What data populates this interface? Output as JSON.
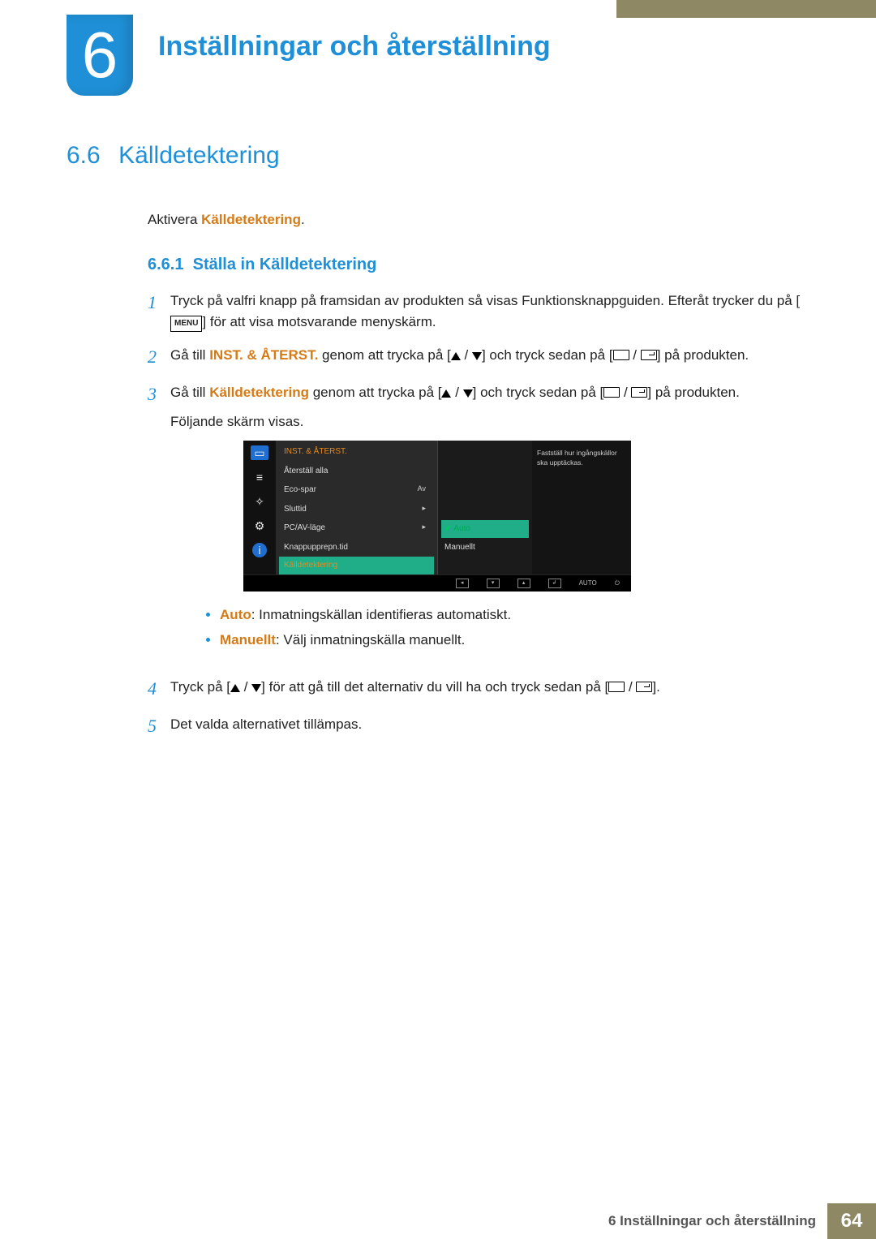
{
  "chapter": {
    "number": "6",
    "title": "Inställningar och återställning"
  },
  "section": {
    "number": "6.6",
    "title": "Källdetektering"
  },
  "intro": {
    "prefix": "Aktivera ",
    "keyword": "Källdetektering",
    "suffix": "."
  },
  "subsection": {
    "number": "6.6.1",
    "title": "Ställa in Källdetektering"
  },
  "steps": {
    "1": {
      "a": "Tryck på valfri knapp på framsidan av produkten så visas Funktionsknappguiden. Efteråt trycker du på [",
      "b": "] för att visa motsvarande menyskärm."
    },
    "2": {
      "a": "Gå till ",
      "kw": "INST. & ÅTERST.",
      "b": " genom att trycka på [",
      "c": "] och tryck sedan på [",
      "d": "] på produkten."
    },
    "3": {
      "a": "Gå till ",
      "kw": "Källdetektering",
      "b": " genom att trycka på [",
      "c": "] och tryck sedan på [",
      "d": "] på produkten.",
      "e": "Följande skärm visas."
    },
    "4": {
      "a": "Tryck på [",
      "b": "] för att gå till det alternativ du vill ha och tryck sedan på [",
      "c": "]."
    },
    "5": "Det valda alternativet tillämpas."
  },
  "osd": {
    "menu_header": "INST. & ÅTERST.",
    "rows": [
      {
        "label": "Återställ alla",
        "val": ""
      },
      {
        "label": "Eco-spar",
        "val": "Av"
      },
      {
        "label": "Sluttid",
        "val": "▸"
      },
      {
        "label": "PC/AV-läge",
        "val": "▸"
      },
      {
        "label": "Knappupprepn.tid",
        "val": ""
      }
    ],
    "selected_label": "Källdetektering",
    "options": {
      "auto": "Auto",
      "manual": "Manuellt"
    },
    "desc": "Fastställ hur ingångskällor ska upptäckas.",
    "footer_auto": "AUTO"
  },
  "bullets": {
    "auto": {
      "kw": "Auto",
      "text": ": Inmatningskällan identifieras automatiskt."
    },
    "manual": {
      "kw": "Manuellt",
      "text": ": Välj inmatningskälla manuellt."
    }
  },
  "menu_label": "MENU",
  "footer": {
    "text": "6 Inställningar och återställning",
    "page": "64"
  }
}
